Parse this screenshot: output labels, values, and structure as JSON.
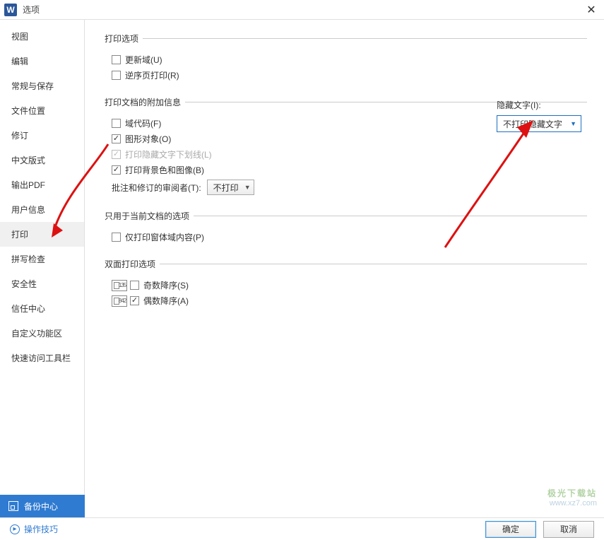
{
  "titlebar": {
    "title": "选项"
  },
  "sidebar": {
    "items": [
      {
        "label": "视图"
      },
      {
        "label": "编辑"
      },
      {
        "label": "常规与保存"
      },
      {
        "label": "文件位置"
      },
      {
        "label": "修订"
      },
      {
        "label": "中文版式"
      },
      {
        "label": "输出PDF"
      },
      {
        "label": "用户信息"
      },
      {
        "label": "打印"
      },
      {
        "label": "拼写检查"
      },
      {
        "label": "安全性"
      },
      {
        "label": "信任中心"
      },
      {
        "label": "自定义功能区"
      },
      {
        "label": "快速访问工具栏"
      }
    ],
    "active_index": 8
  },
  "sections": {
    "print_options": {
      "legend": "打印选项",
      "update_fields": "更新域(U)",
      "reverse_order": "逆序页打印(R)"
    },
    "doc_extra": {
      "legend": "打印文档的附加信息",
      "field_codes": "域代码(F)",
      "drawing_objects": "图形对象(O)",
      "hidden_underline": "打印隐藏文字下划线(L)",
      "background": "打印背景色和图像(B)",
      "reviewer_label": "批注和修订的审阅者(T):",
      "reviewer_value": "不打印"
    },
    "hidden_text": {
      "label": "隐藏文字(I):",
      "value": "不打印隐藏文字"
    },
    "current_doc": {
      "legend": "只用于当前文档的选项",
      "form_only": "仅打印窗体域内容(P)"
    },
    "duplex": {
      "legend": "双面打印选项",
      "odd_desc": "奇数降序(S)",
      "even_desc": "偶数降序(A)",
      "odd_digits": "135",
      "even_digits": "842"
    }
  },
  "backup": {
    "label": "备份中心"
  },
  "bottom": {
    "tips": "操作技巧",
    "ok": "确定",
    "cancel": "取消"
  },
  "watermark": {
    "l1": "极光下载站",
    "l2": "www.xz7.com"
  }
}
